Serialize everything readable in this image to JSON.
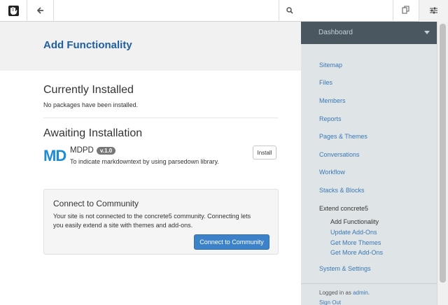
{
  "toolbar": {
    "logo_icon": "concrete5-hand-icon",
    "back_icon": "arrow-left-icon",
    "search_icon": "search-icon",
    "search_value": "",
    "pages_icon": "pages-icon",
    "settings_icon": "sliders-icon"
  },
  "page": {
    "title": "Add Functionality"
  },
  "installed": {
    "heading": "Currently Installed",
    "empty_text": "No packages have been installed."
  },
  "awaiting": {
    "heading": "Awaiting Installation",
    "package": {
      "logo": "MD",
      "name": "MDPD",
      "version": "v.1.0",
      "description": "To indicate markdowntext by using parsedown library.",
      "install_label": "Install"
    }
  },
  "community": {
    "title": "Connect to Community",
    "text": "Your site is not connected to the concrete5 community. Connecting lets you easily extend a site with themes and add-ons.",
    "button_label": "Connect to Community"
  },
  "panel": {
    "header": "Dashboard",
    "links": [
      "Sitemap",
      "Files",
      "Members",
      "Reports",
      "Pages & Themes",
      "Conversations",
      "Workflow",
      "Stacks & Blocks"
    ],
    "group": "Extend concrete5",
    "sub_items": [
      "Add Functionality",
      "Update Add-Ons",
      "Get More Themes",
      "Get More Add-Ons"
    ],
    "system": "System & Settings",
    "logged_in_prefix": "Logged in as",
    "user": "admin",
    "logged_in_suffix": ".",
    "sign_out": "Sign Out"
  },
  "colors": {
    "title_blue": "#1e5f9e",
    "link_blue": "#3a78b5",
    "button_blue": "#3b82c8",
    "panel_bg": "#dfe4e7",
    "panel_header_bg": "#4a5660"
  }
}
